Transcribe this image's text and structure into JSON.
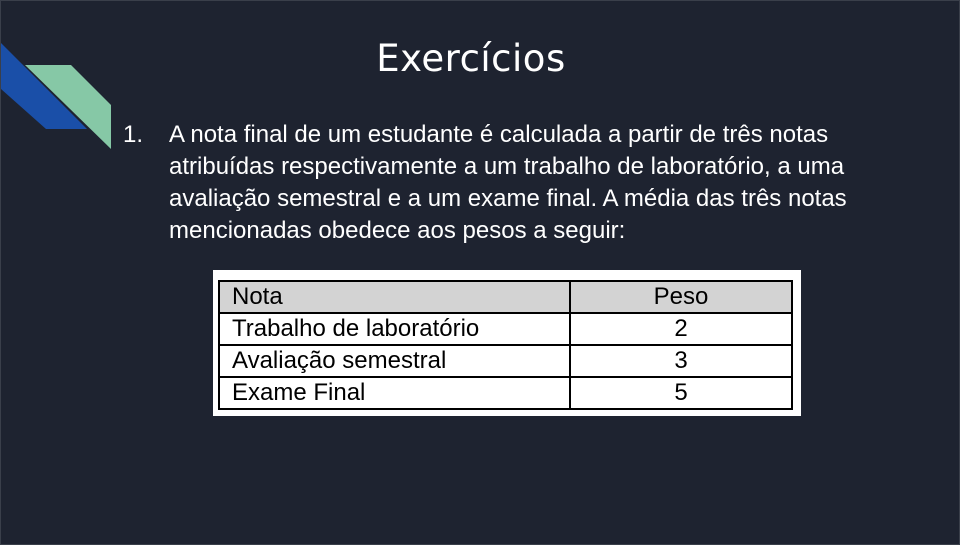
{
  "slide": {
    "title": "Exercícios",
    "item_number": "1.",
    "item_text": "A nota final de um estudante é calculada a partir de três notas atribuídas respectivamente a um trabalho de laboratório, a uma avaliação semestral e a um exame final. A média das três notas mencionadas obedece aos pesos a seguir:",
    "colors": {
      "background": "#1e2330",
      "accent_blue": "#1a4fa8",
      "accent_green": "#86c8a6"
    }
  },
  "table": {
    "headers": [
      "Nota",
      "Peso"
    ],
    "rows": [
      [
        "Trabalho de laboratório",
        "2"
      ],
      [
        "Avaliação semestral",
        "3"
      ],
      [
        "Exame Final",
        "5"
      ]
    ]
  }
}
